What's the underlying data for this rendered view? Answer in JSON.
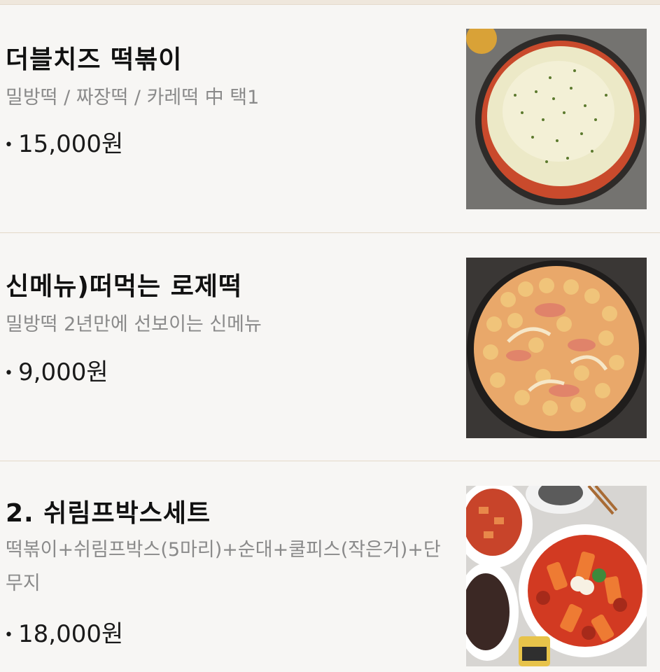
{
  "menu": {
    "items": [
      {
        "name": "더블치즈 떡볶이",
        "description": "밀방떡 / 짜장떡 / 카레떡 中 택1",
        "price": "15,000원",
        "image": "double-cheese-tteokbokki-photo"
      },
      {
        "name": "신메뉴)떠먹는 로제떡",
        "description": "밀방떡 2년만에 선보이는 신메뉴",
        "price": "9,000원",
        "image": "rose-tteokbokki-photo"
      },
      {
        "name": "2. 쉬림프박스세트",
        "description": "떡볶이+쉬림프박스(5마리)+순대+쿨피스(작은거)+단무지",
        "price": "18,000원",
        "image": "shrimp-box-set-photo"
      }
    ]
  },
  "colors": {
    "background": "#f7f6f4",
    "divider": "#e4d8c8",
    "description_text": "#8a8a8a",
    "name_text": "#111111"
  }
}
